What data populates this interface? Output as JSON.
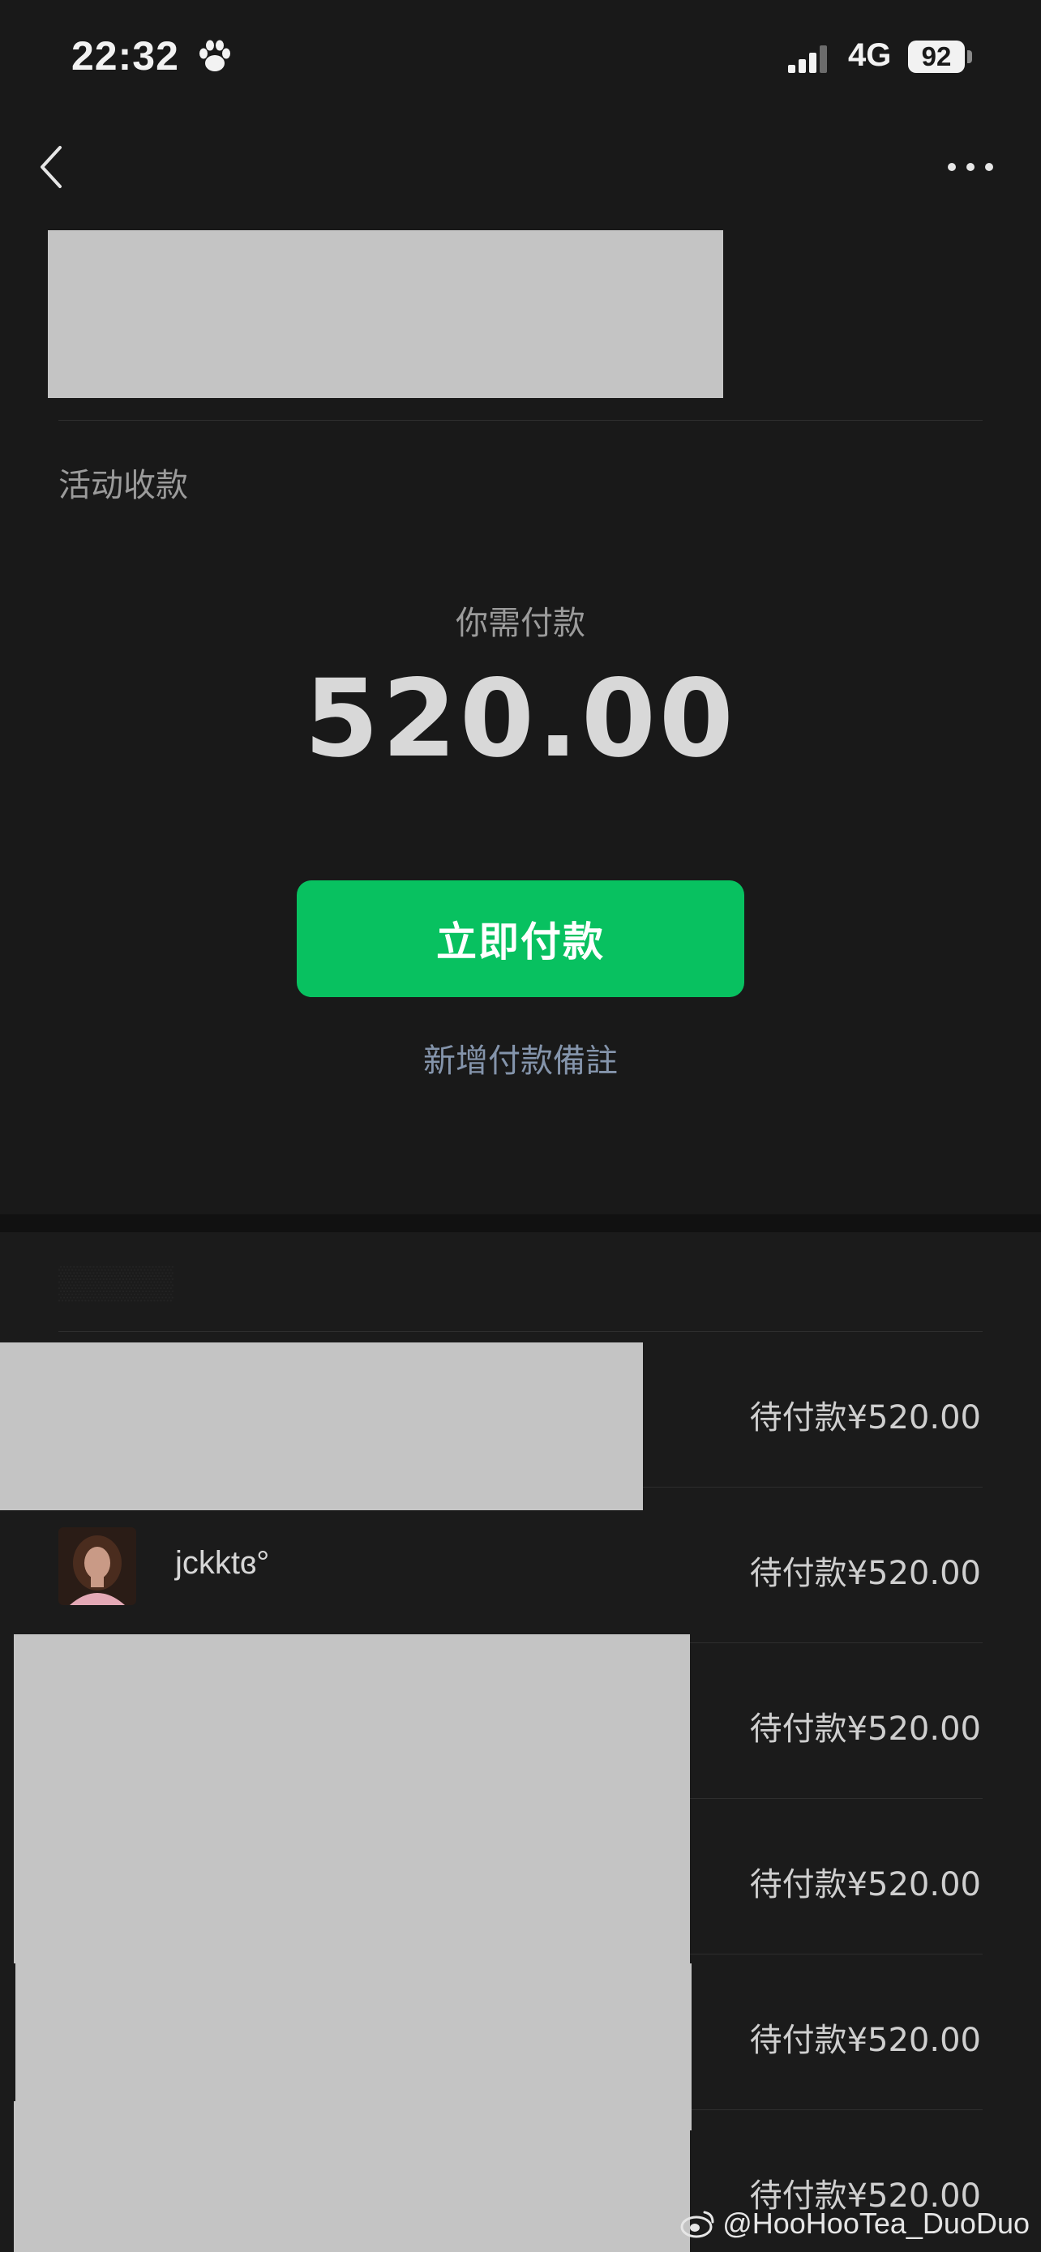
{
  "status_bar": {
    "time": "22:32",
    "network": "4G",
    "battery": "92",
    "icons": [
      "paw-icon",
      "signal-icon"
    ]
  },
  "nav": {
    "back_icon": "chevron-left-icon",
    "more_icon": "ellipsis-icon"
  },
  "header": {
    "section_label": "活动收款"
  },
  "payment": {
    "prompt": "你需付款",
    "amount": "520.00",
    "pay_button_label": "立即付款",
    "add_note_label": "新增付款備註"
  },
  "payers": [
    {
      "name": "",
      "status": "待付款¥520.00",
      "redacted": true
    },
    {
      "name": "jckktɞ°",
      "status": "待付款¥520.00",
      "redacted": false
    },
    {
      "name": "",
      "status": "待付款¥520.00",
      "redacted": true
    },
    {
      "name": "",
      "status": "待付款¥520.00",
      "redacted": true
    },
    {
      "name": "",
      "status": "待付款¥520.00",
      "redacted": true
    },
    {
      "name": "",
      "status": "待付款¥520.00",
      "redacted": true
    }
  ],
  "watermark": "@HooHooTea_DuoDuo",
  "colors": {
    "background": "#191919",
    "accent_green": "#08c160",
    "link_blue": "#8494ab",
    "redaction": "#c4c4c4"
  }
}
